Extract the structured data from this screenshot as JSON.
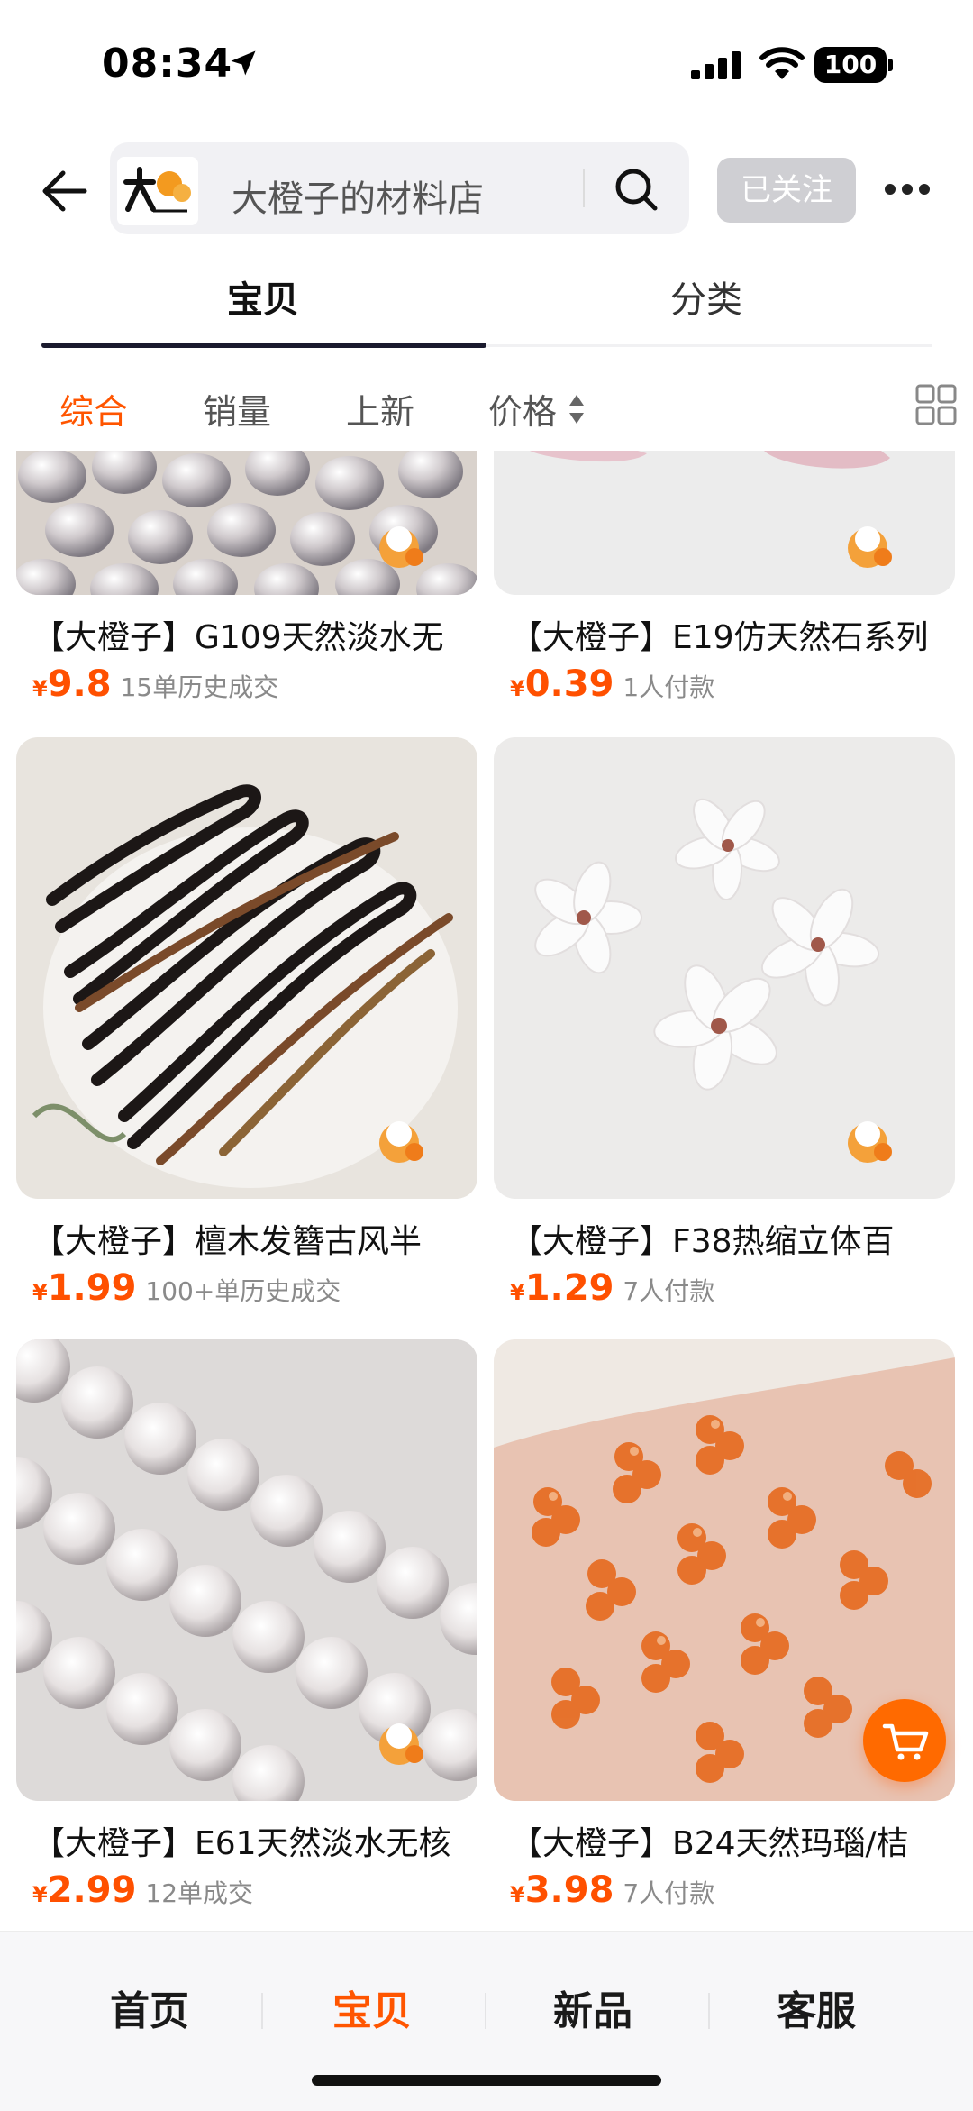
{
  "status_bar": {
    "time": "08:34",
    "battery": "100"
  },
  "header": {
    "shop_name": "大橙子的材料店",
    "follow_label": "已关注"
  },
  "tabs": [
    {
      "label": "宝贝"
    },
    {
      "label": "分类"
    }
  ],
  "sort": [
    {
      "label": "综合"
    },
    {
      "label": "销量"
    },
    {
      "label": "上新"
    },
    {
      "label": "价格"
    }
  ],
  "products": [
    {
      "title": "【大橙子】G109天然淡水无",
      "currency": "¥",
      "price": "9.8",
      "sales": "15单历史成交",
      "image": "pearls-drop"
    },
    {
      "title": "【大橙子】E19仿天然石系列",
      "currency": "¥",
      "price": "0.39",
      "sales": "1人付款",
      "image": "pink-stone"
    },
    {
      "title": "【大橙子】檀木发簪古风半",
      "currency": "¥",
      "price": "1.99",
      "sales": "100+单历史成交",
      "image": "wooden-hairpins"
    },
    {
      "title": "【大橙子】F38热缩立体百",
      "currency": "¥",
      "price": "1.29",
      "sales": "7人付款",
      "image": "white-flowers"
    },
    {
      "title": "【大橙子】E61天然淡水无核",
      "currency": "¥",
      "price": "2.99",
      "sales": "12单成交",
      "image": "pearl-strands"
    },
    {
      "title": "【大橙子】B24天然玛瑙/桔",
      "currency": "¥",
      "price": "3.98",
      "sales": "7人付款",
      "image": "agate-beads"
    }
  ],
  "bottom_nav": [
    {
      "label": "首页"
    },
    {
      "label": "宝贝"
    },
    {
      "label": "新品"
    },
    {
      "label": "客服"
    }
  ],
  "colors": {
    "accent": "#ff5500",
    "price": "#ff5000",
    "tab_indicator": "#1a1a2e"
  }
}
